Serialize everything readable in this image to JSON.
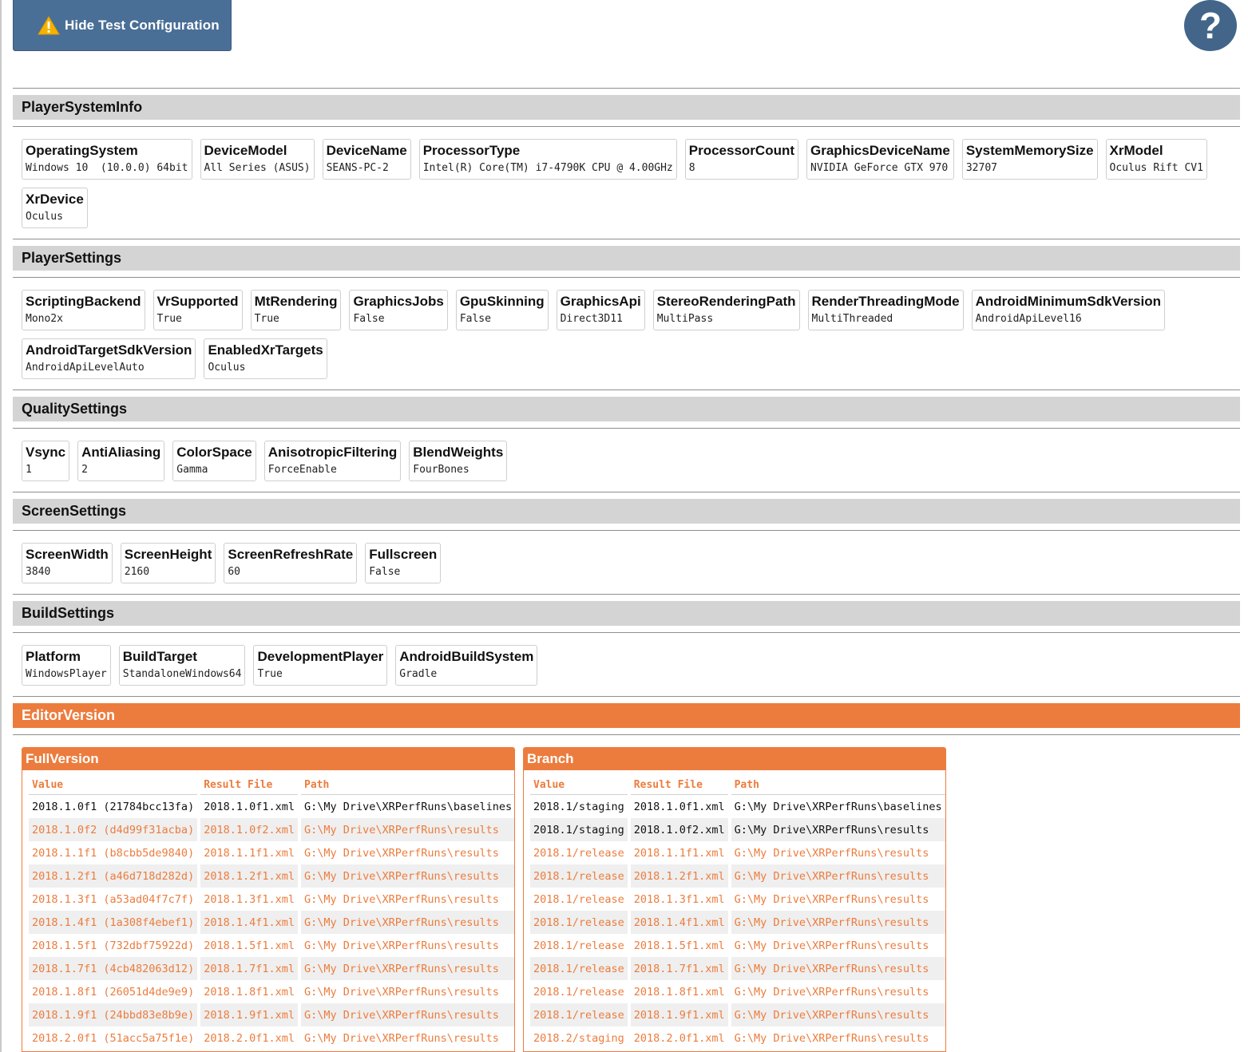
{
  "toolbar": {
    "hide_label": "Hide Test Configuration",
    "warning_icon": "warning-icon",
    "help_label": "?"
  },
  "colors": {
    "accent": "#ec7c3d",
    "button_blue": "#4a6f96",
    "section_header_bg": "#d4d4d4"
  },
  "sections": {
    "player_system_info": {
      "title": "PlayerSystemInfo",
      "items": [
        {
          "key": "OperatingSystem",
          "value": "Windows 10  (10.0.0) 64bit"
        },
        {
          "key": "DeviceModel",
          "value": "All Series (ASUS)"
        },
        {
          "key": "DeviceName",
          "value": "SEANS-PC-2"
        },
        {
          "key": "ProcessorType",
          "value": "Intel(R) Core(TM) i7-4790K CPU @ 4.00GHz"
        },
        {
          "key": "ProcessorCount",
          "value": "8"
        },
        {
          "key": "GraphicsDeviceName",
          "value": "NVIDIA GeForce GTX 970"
        },
        {
          "key": "SystemMemorySize",
          "value": "32707"
        },
        {
          "key": "XrModel",
          "value": "Oculus Rift CV1"
        },
        {
          "key": "XrDevice",
          "value": "Oculus"
        }
      ]
    },
    "player_settings": {
      "title": "PlayerSettings",
      "items": [
        {
          "key": "ScriptingBackend",
          "value": "Mono2x"
        },
        {
          "key": "VrSupported",
          "value": "True"
        },
        {
          "key": "MtRendering",
          "value": "True"
        },
        {
          "key": "GraphicsJobs",
          "value": "False"
        },
        {
          "key": "GpuSkinning",
          "value": "False"
        },
        {
          "key": "GraphicsApi",
          "value": "Direct3D11"
        },
        {
          "key": "StereoRenderingPath",
          "value": "MultiPass"
        },
        {
          "key": "RenderThreadingMode",
          "value": "MultiThreaded"
        },
        {
          "key": "AndroidMinimumSdkVersion",
          "value": "AndroidApiLevel16"
        },
        {
          "key": "AndroidTargetSdkVersion",
          "value": "AndroidApiLevelAuto"
        },
        {
          "key": "EnabledXrTargets",
          "value": "Oculus"
        }
      ]
    },
    "quality_settings": {
      "title": "QualitySettings",
      "items": [
        {
          "key": "Vsync",
          "value": "1"
        },
        {
          "key": "AntiAliasing",
          "value": "2"
        },
        {
          "key": "ColorSpace",
          "value": "Gamma"
        },
        {
          "key": "AnisotropicFiltering",
          "value": "ForceEnable"
        },
        {
          "key": "BlendWeights",
          "value": "FourBones"
        }
      ]
    },
    "screen_settings": {
      "title": "ScreenSettings",
      "items": [
        {
          "key": "ScreenWidth",
          "value": "3840"
        },
        {
          "key": "ScreenHeight",
          "value": "2160"
        },
        {
          "key": "ScreenRefreshRate",
          "value": "60"
        },
        {
          "key": "Fullscreen",
          "value": "False"
        }
      ]
    },
    "build_settings": {
      "title": "BuildSettings",
      "items": [
        {
          "key": "Platform",
          "value": "WindowsPlayer"
        },
        {
          "key": "BuildTarget",
          "value": "StandaloneWindows64"
        },
        {
          "key": "DevelopmentPlayer",
          "value": "True"
        },
        {
          "key": "AndroidBuildSystem",
          "value": "Gradle"
        }
      ]
    },
    "editor_version": {
      "title": "EditorVersion"
    }
  },
  "full_version": {
    "title": "FullVersion",
    "columns": [
      "Value",
      "Result File",
      "Path"
    ],
    "rows": [
      {
        "value": "2018.1.0f1 (21784bcc13fa)",
        "file": "2018.1.0f1.xml",
        "path": "G:\\My Drive\\XRPerfRuns\\baselines",
        "active": true
      },
      {
        "value": "2018.1.0f2 (d4d99f31acba)",
        "file": "2018.1.0f2.xml",
        "path": "G:\\My Drive\\XRPerfRuns\\results",
        "active": false
      },
      {
        "value": "2018.1.1f1 (b8cbb5de9840)",
        "file": "2018.1.1f1.xml",
        "path": "G:\\My Drive\\XRPerfRuns\\results",
        "active": false
      },
      {
        "value": "2018.1.2f1 (a46d718d282d)",
        "file": "2018.1.2f1.xml",
        "path": "G:\\My Drive\\XRPerfRuns\\results",
        "active": false
      },
      {
        "value": "2018.1.3f1 (a53ad04f7c7f)",
        "file": "2018.1.3f1.xml",
        "path": "G:\\My Drive\\XRPerfRuns\\results",
        "active": false
      },
      {
        "value": "2018.1.4f1 (1a308f4ebef1)",
        "file": "2018.1.4f1.xml",
        "path": "G:\\My Drive\\XRPerfRuns\\results",
        "active": false
      },
      {
        "value": "2018.1.5f1 (732dbf75922d)",
        "file": "2018.1.5f1.xml",
        "path": "G:\\My Drive\\XRPerfRuns\\results",
        "active": false
      },
      {
        "value": "2018.1.7f1 (4cb482063d12)",
        "file": "2018.1.7f1.xml",
        "path": "G:\\My Drive\\XRPerfRuns\\results",
        "active": false
      },
      {
        "value": "2018.1.8f1 (26051d4de9e9)",
        "file": "2018.1.8f1.xml",
        "path": "G:\\My Drive\\XRPerfRuns\\results",
        "active": false
      },
      {
        "value": "2018.1.9f1 (24bbd83e8b9e)",
        "file": "2018.1.9f1.xml",
        "path": "G:\\My Drive\\XRPerfRuns\\results",
        "active": false
      },
      {
        "value": "2018.2.0f1 (51acc5a75f1e)",
        "file": "2018.2.0f1.xml",
        "path": "G:\\My Drive\\XRPerfRuns\\results",
        "active": false
      }
    ]
  },
  "branch": {
    "title": "Branch",
    "columns": [
      "Value",
      "Result File",
      "Path"
    ],
    "rows": [
      {
        "value": "2018.1/staging",
        "file": "2018.1.0f1.xml",
        "path": "G:\\My Drive\\XRPerfRuns\\baselines",
        "active": true
      },
      {
        "value": "2018.1/staging",
        "file": "2018.1.0f2.xml",
        "path": "G:\\My Drive\\XRPerfRuns\\results",
        "active": true
      },
      {
        "value": "2018.1/release",
        "file": "2018.1.1f1.xml",
        "path": "G:\\My Drive\\XRPerfRuns\\results",
        "active": false
      },
      {
        "value": "2018.1/release",
        "file": "2018.1.2f1.xml",
        "path": "G:\\My Drive\\XRPerfRuns\\results",
        "active": false
      },
      {
        "value": "2018.1/release",
        "file": "2018.1.3f1.xml",
        "path": "G:\\My Drive\\XRPerfRuns\\results",
        "active": false
      },
      {
        "value": "2018.1/release",
        "file": "2018.1.4f1.xml",
        "path": "G:\\My Drive\\XRPerfRuns\\results",
        "active": false
      },
      {
        "value": "2018.1/release",
        "file": "2018.1.5f1.xml",
        "path": "G:\\My Drive\\XRPerfRuns\\results",
        "active": false
      },
      {
        "value": "2018.1/release",
        "file": "2018.1.7f1.xml",
        "path": "G:\\My Drive\\XRPerfRuns\\results",
        "active": false
      },
      {
        "value": "2018.1/release",
        "file": "2018.1.8f1.xml",
        "path": "G:\\My Drive\\XRPerfRuns\\results",
        "active": false
      },
      {
        "value": "2018.1/release",
        "file": "2018.1.9f1.xml",
        "path": "G:\\My Drive\\XRPerfRuns\\results",
        "active": false
      },
      {
        "value": "2018.2/staging",
        "file": "2018.2.0f1.xml",
        "path": "G:\\My Drive\\XRPerfRuns\\results",
        "active": false
      }
    ]
  }
}
